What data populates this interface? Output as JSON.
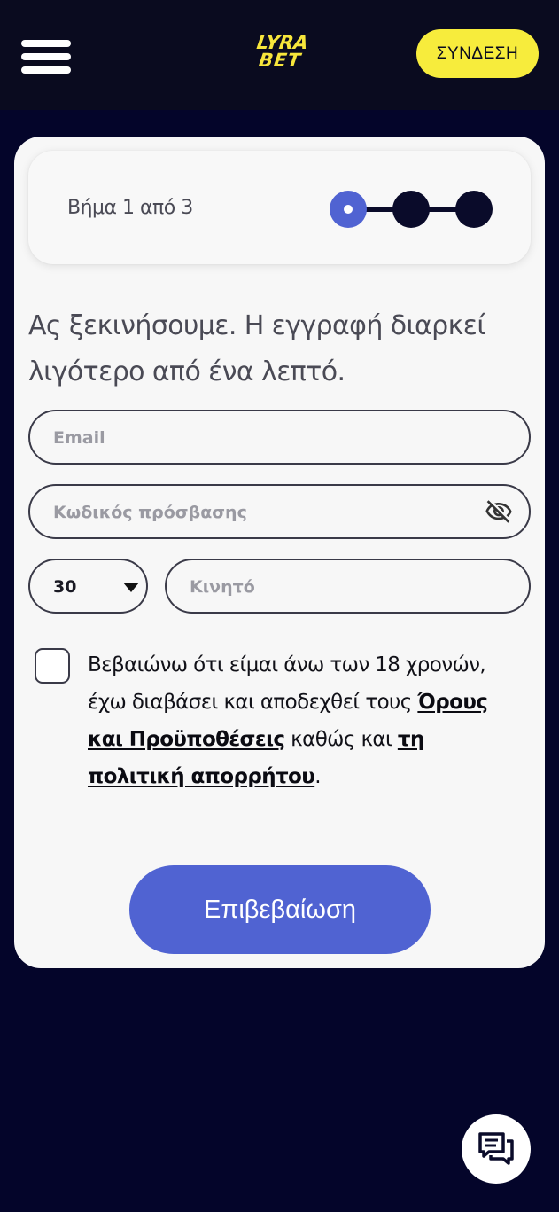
{
  "header": {
    "menu_icon": "hamburger-menu-icon",
    "logo": {
      "line1": "LYRA",
      "line2": "BET",
      "color": "#f7e63b"
    },
    "login_label": "ΣΥΝΔΕΣΗ"
  },
  "steps": {
    "label": "Βήμα 1 από 3",
    "current": 1,
    "total": 3,
    "active_color": "#5063d2"
  },
  "intro": "Ας ξεκινήσουμε. Η εγγραφή διαρκεί λιγότερο από ένα λεπτό.",
  "form": {
    "email_placeholder": "Email",
    "password_placeholder": "Κωδικός πρόσβασης",
    "password_toggle_icon": "eye-off-icon",
    "prefix_value": "30",
    "phone_placeholder": "Κινητό"
  },
  "consent": {
    "text_1": "Βεβαιώνω ότι είμαι άνω των 18 χρονών, έχω διαβάσει και αποδεχθεί τους ",
    "terms_link": "Όρους και Προϋποθέσεις",
    "text_2": " καθώς και ",
    "privacy_link": "τη πολιτική απορρήτου",
    "text_3": "."
  },
  "confirm_label": "Επιβεβαίωση",
  "chat_icon": "chat-icon",
  "colors": {
    "background": "#04052a",
    "header": "#0a0b1f",
    "login_button": "#f7ec3c",
    "primary": "#5063d2"
  }
}
